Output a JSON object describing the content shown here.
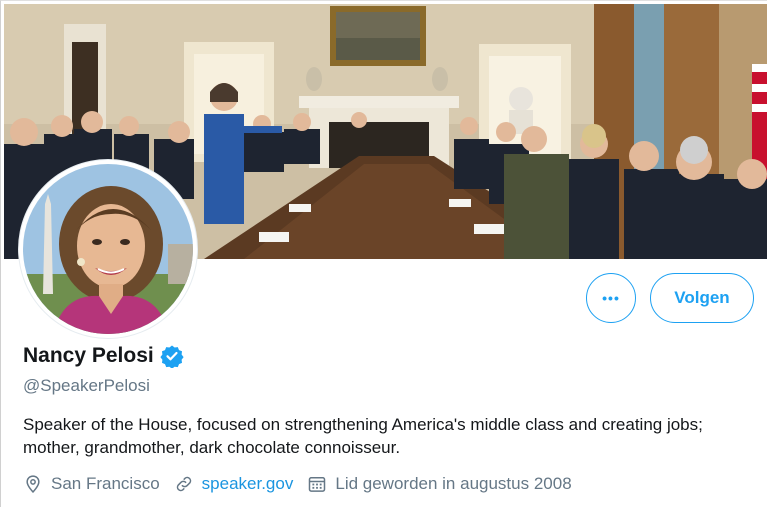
{
  "profile": {
    "name": "Nancy Pelosi",
    "handle": "@SpeakerPelosi",
    "verified": true,
    "bio": "Speaker of the House, focused on strengthening America's middle class and creating jobs; mother, grandmother, dark chocolate connoisseur.",
    "location": "San Francisco",
    "website": "speaker.gov",
    "joined": "Lid geworden in augustus 2008"
  },
  "actions": {
    "more_label": "•••",
    "follow_label": "Volgen"
  },
  "colors": {
    "accent": "#1da1f2",
    "link": "#1b95e0",
    "secondary_text": "#657786",
    "primary_text": "#14171a"
  },
  "icons": {
    "verified": "verified-badge-icon",
    "location": "location-pin-icon",
    "website": "link-icon",
    "joined": "calendar-icon"
  }
}
